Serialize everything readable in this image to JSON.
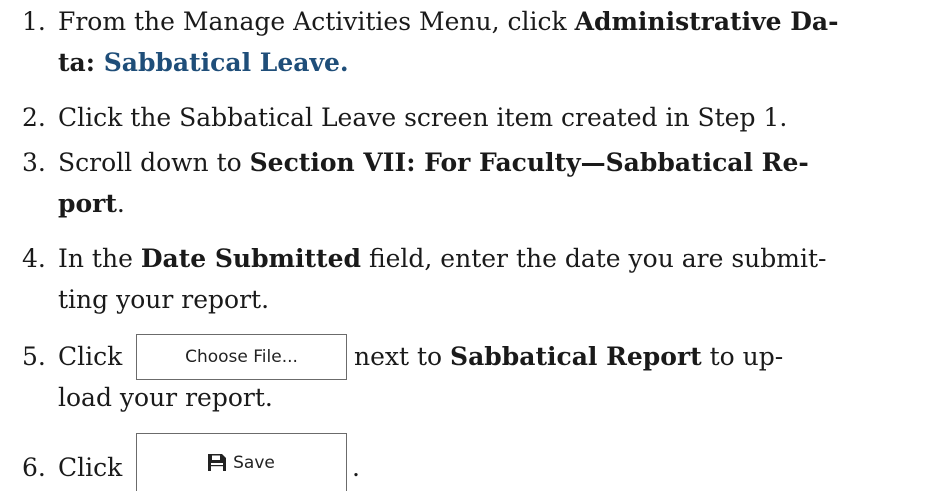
{
  "steps": [
    {
      "number": "1.",
      "text_a": "From the Manage Activities Menu, click ",
      "bold_a": "Administrative Da-",
      "bold_b": "ta: ",
      "link_b": "Sabbatical Leave."
    },
    {
      "number": "2.",
      "text": "Click the Sabbatical Leave screen item created in Step 1."
    },
    {
      "number": "3.",
      "text_a": "Scroll down to ",
      "bold_a": "Section VII: For Faculty—Sabbatical Re-",
      "bold_b": "port",
      "text_b": "."
    },
    {
      "number": "4.",
      "text_a": "In the ",
      "bold_a": "Date Submitted",
      "text_a2": " field, enter the date you are submit-",
      "text_b": "ting your report."
    },
    {
      "number": "5.",
      "text_a": "Click",
      "button": "Choose File...",
      "text_a2": "next to ",
      "bold_a": "Sabbatical Report",
      "text_a3": " to up-",
      "text_b": "load your report."
    },
    {
      "number": "6.",
      "text_a": "Click",
      "button": "Save",
      "button_icon": "floppy-disk-icon",
      "text_a2": "."
    }
  ]
}
